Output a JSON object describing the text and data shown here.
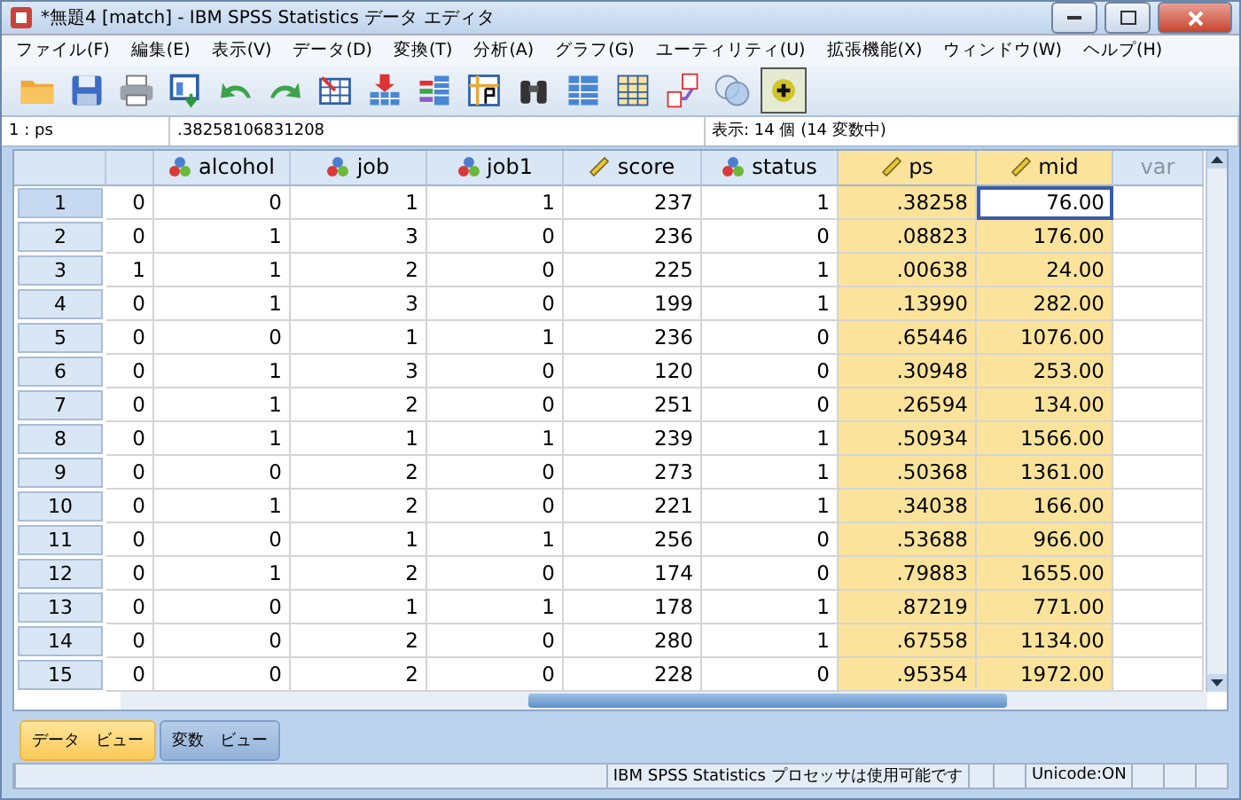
{
  "window": {
    "title": "*無題4 [match] - IBM SPSS Statistics データ エディタ"
  },
  "menu": [
    "ファイル(F)",
    "編集(E)",
    "表示(V)",
    "データ(D)",
    "変換(T)",
    "分析(A)",
    "グラフ(G)",
    "ユーティリティ(U)",
    "拡張機能(X)",
    "ウィンドウ(W)",
    "ヘルプ(H)"
  ],
  "cell_editor": {
    "cell_ref": "1 : ps",
    "value": ".38258106831208",
    "visible_info": "表示: 14 個 (14 変数中)"
  },
  "table": {
    "columns": [
      {
        "kind": "unnamed",
        "highlighted": false
      },
      {
        "label": "alcohol",
        "kind": "nominal",
        "highlighted": false
      },
      {
        "label": "job",
        "kind": "nominal",
        "highlighted": false
      },
      {
        "label": "job1",
        "kind": "nominal",
        "highlighted": false
      },
      {
        "label": "score",
        "kind": "scale",
        "highlighted": false
      },
      {
        "label": "status",
        "kind": "nominal",
        "highlighted": false
      },
      {
        "label": "ps",
        "kind": "scale",
        "highlighted": true
      },
      {
        "label": "mid",
        "kind": "scale",
        "highlighted": true
      },
      {
        "label": "var",
        "kind": "empty",
        "highlighted": false
      }
    ],
    "rows": [
      {
        "label": "1",
        "selected": true,
        "cells": [
          "0",
          "0",
          "1",
          "1",
          "237",
          "1",
          ".38258",
          "76.00"
        ]
      },
      {
        "label": "2",
        "selected": false,
        "cells": [
          "0",
          "1",
          "3",
          "0",
          "236",
          "0",
          ".08823",
          "176.00"
        ]
      },
      {
        "label": "3",
        "selected": false,
        "cells": [
          "1",
          "1",
          "2",
          "0",
          "225",
          "1",
          ".00638",
          "24.00"
        ]
      },
      {
        "label": "4",
        "selected": false,
        "cells": [
          "0",
          "1",
          "3",
          "0",
          "199",
          "1",
          ".13990",
          "282.00"
        ]
      },
      {
        "label": "5",
        "selected": false,
        "cells": [
          "0",
          "0",
          "1",
          "1",
          "236",
          "0",
          ".65446",
          "1076.00"
        ]
      },
      {
        "label": "6",
        "selected": false,
        "cells": [
          "0",
          "1",
          "3",
          "0",
          "120",
          "0",
          ".30948",
          "253.00"
        ]
      },
      {
        "label": "7",
        "selected": false,
        "cells": [
          "0",
          "1",
          "2",
          "0",
          "251",
          "0",
          ".26594",
          "134.00"
        ]
      },
      {
        "label": "8",
        "selected": false,
        "cells": [
          "0",
          "1",
          "1",
          "1",
          "239",
          "1",
          ".50934",
          "1566.00"
        ]
      },
      {
        "label": "9",
        "selected": false,
        "cells": [
          "0",
          "0",
          "2",
          "0",
          "273",
          "1",
          ".50368",
          "1361.00"
        ]
      },
      {
        "label": "10",
        "selected": false,
        "cells": [
          "0",
          "1",
          "2",
          "0",
          "221",
          "1",
          ".34038",
          "166.00"
        ]
      },
      {
        "label": "11",
        "selected": false,
        "cells": [
          "0",
          "0",
          "1",
          "1",
          "256",
          "0",
          ".53688",
          "966.00"
        ]
      },
      {
        "label": "12",
        "selected": false,
        "cells": [
          "0",
          "1",
          "2",
          "0",
          "174",
          "0",
          ".79883",
          "1655.00"
        ]
      },
      {
        "label": "13",
        "selected": false,
        "cells": [
          "0",
          "0",
          "1",
          "1",
          "178",
          "1",
          ".87219",
          "771.00"
        ]
      },
      {
        "label": "14",
        "selected": false,
        "cells": [
          "0",
          "0",
          "2",
          "0",
          "280",
          "1",
          ".67558",
          "1134.00"
        ]
      },
      {
        "label": "15",
        "selected": false,
        "cells": [
          "0",
          "0",
          "2",
          "0",
          "228",
          "0",
          ".95354",
          "1972.00"
        ]
      }
    ]
  },
  "view_tabs": [
    {
      "label": "データ　ビュー",
      "selected": true
    },
    {
      "label": "変数　ビュー",
      "selected": false
    }
  ],
  "status_bar": {
    "message": "IBM SPSS Statistics プロセッサは使用可能です",
    "encoding": "Unicode:ON"
  }
}
